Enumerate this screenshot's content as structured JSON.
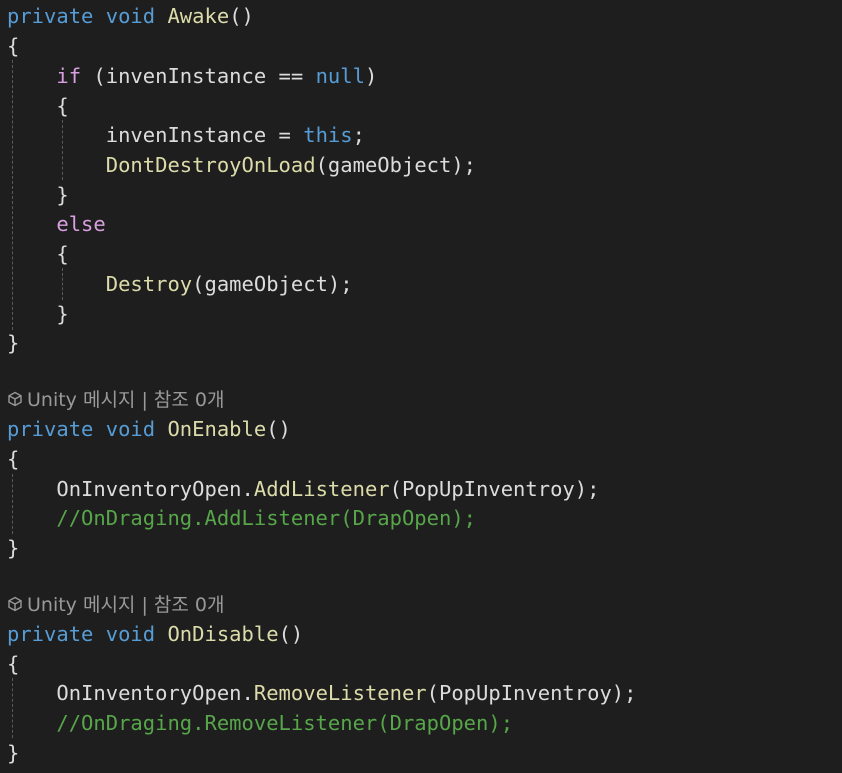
{
  "code": {
    "awake": {
      "sig_private": "private",
      "sig_void": "void",
      "sig_name": "Awake",
      "sig_parens": "()",
      "open_brace": "{",
      "if_kw": "if",
      "if_open": "(",
      "if_var": "invenInstance",
      "if_op": " == ",
      "if_null": "null",
      "if_close": ")",
      "inner_open_brace": "{",
      "assign_var": "invenInstance",
      "assign_op": " = ",
      "assign_this": "this",
      "assign_semi": ";",
      "ddol_method": "DontDestroyOnLoad",
      "ddol_args": "(gameObject);",
      "inner_close_brace": "}",
      "else_kw": "else",
      "else_open_brace": "{",
      "destroy_method": "Destroy",
      "destroy_args": "(gameObject);",
      "else_close_brace": "}",
      "close_brace": "}"
    },
    "onenable": {
      "codelens": "Unity 메시지 | 참조 0개",
      "sig_private": "private",
      "sig_void": "void",
      "sig_name": "OnEnable",
      "sig_parens": "()",
      "open_brace": "{",
      "stmt_obj": "OnInventoryOpen",
      "stmt_dot": ".",
      "stmt_method": "AddListener",
      "stmt_args": "(PopUpInventroy);",
      "comment": "//OnDraging.AddListener(DrapOpen);",
      "close_brace": "}"
    },
    "ondisable": {
      "codelens": "Unity 메시지 | 참조 0개",
      "sig_private": "private",
      "sig_void": "void",
      "sig_name": "OnDisable",
      "sig_parens": "()",
      "open_brace": "{",
      "stmt_obj": "OnInventoryOpen",
      "stmt_dot": ".",
      "stmt_method": "RemoveListener",
      "stmt_args": "(PopUpInventroy);",
      "comment": "//OnDraging.RemoveListener(DrapOpen);",
      "close_brace": "}"
    }
  },
  "colors": {
    "background": "#1e1e1e",
    "keyword": "#569cd6",
    "control": "#d8a0df",
    "method": "#dcdcaa",
    "identifier": "#dcdcdc",
    "comment": "#57a64a",
    "codelens": "#999999"
  },
  "icons": {
    "codelens_icon": "unity-cube-icon"
  }
}
